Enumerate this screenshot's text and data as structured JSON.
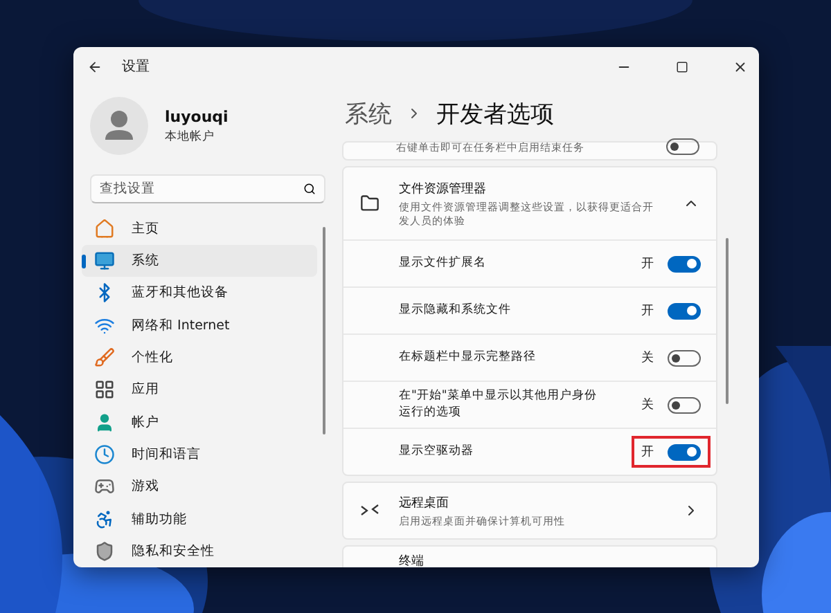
{
  "window": {
    "title": "设置"
  },
  "account": {
    "name": "luyouqi",
    "type": "本地帐户"
  },
  "search": {
    "placeholder": "查找设置"
  },
  "sidebar": {
    "items": [
      {
        "label": "主页",
        "selected": false
      },
      {
        "label": "系统",
        "selected": true
      },
      {
        "label": "蓝牙和其他设备",
        "selected": false
      },
      {
        "label": "网络和 Internet",
        "selected": false
      },
      {
        "label": "个性化",
        "selected": false
      },
      {
        "label": "应用",
        "selected": false
      },
      {
        "label": "帐户",
        "selected": false
      },
      {
        "label": "时间和语言",
        "selected": false
      },
      {
        "label": "游戏",
        "selected": false
      },
      {
        "label": "辅助功能",
        "selected": false
      },
      {
        "label": "隐私和安全性",
        "selected": false
      }
    ]
  },
  "breadcrumb": {
    "parent": "系统",
    "current": "开发者选项"
  },
  "top_card": {
    "description": "右键单击即可在任务栏中启用结束任务",
    "on": false
  },
  "file_explorer": {
    "title": "文件资源管理器",
    "description": "使用文件资源管理器调整这些设置，以获得更适合开发人员的体验",
    "expanded": true,
    "options": [
      {
        "label": "显示文件扩展名",
        "state": "开",
        "on": true,
        "highlighted": false
      },
      {
        "label": "显示隐藏和系统文件",
        "state": "开",
        "on": true,
        "highlighted": false
      },
      {
        "label": "在标题栏中显示完整路径",
        "state": "关",
        "on": false,
        "highlighted": false
      },
      {
        "label": "在\"开始\"菜单中显示以其他用户身份运行的选项",
        "state": "关",
        "on": false,
        "highlighted": false
      },
      {
        "label": "显示空驱动器",
        "state": "开",
        "on": true,
        "highlighted": true
      }
    ]
  },
  "remote_desktop": {
    "title": "远程桌面",
    "description": "启用远程桌面并确保计算机可用性"
  },
  "terminal": {
    "title": "终端"
  }
}
